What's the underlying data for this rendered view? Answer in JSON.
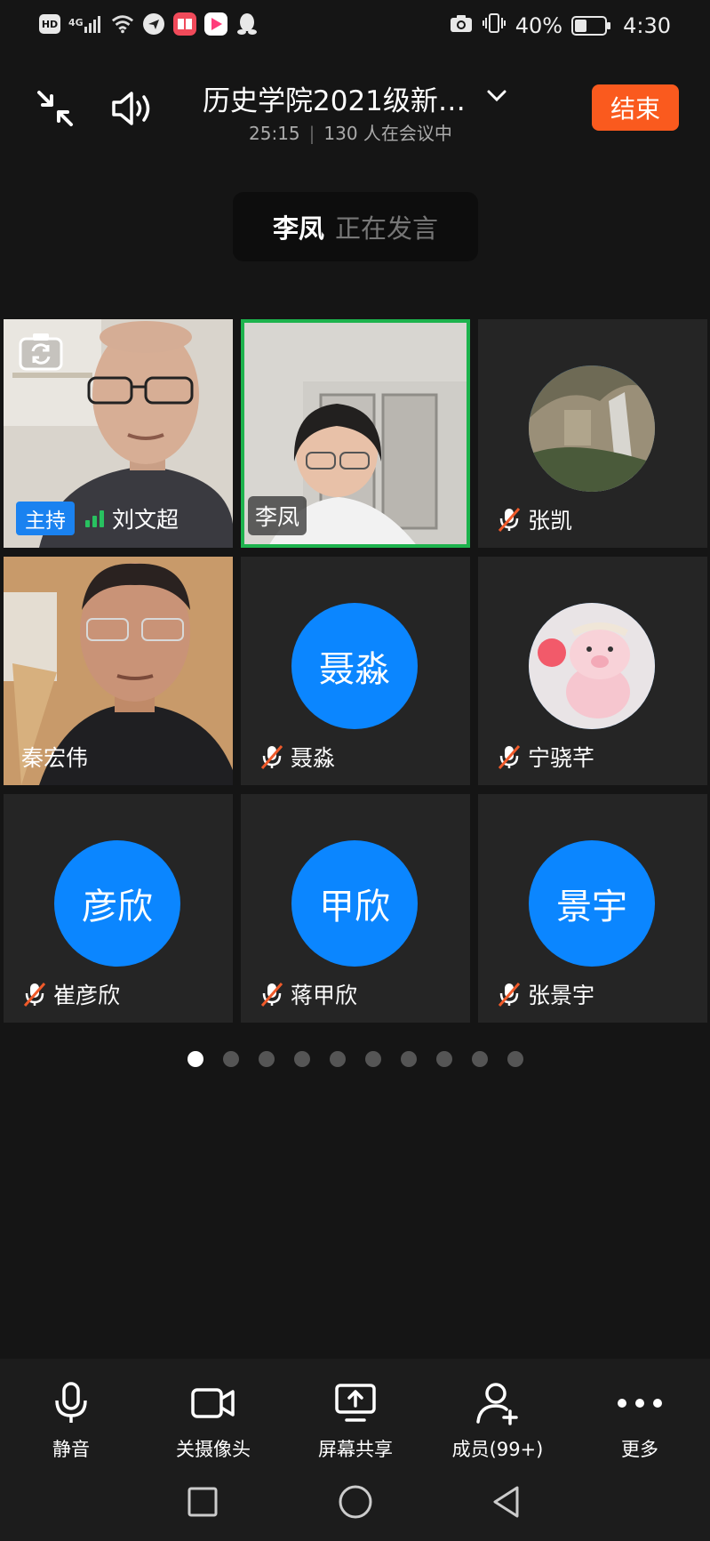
{
  "status_bar": {
    "hd_badge": "HD",
    "network": "4G",
    "battery_percent": "40%",
    "battery_level": 0.4,
    "time": "4:30"
  },
  "header": {
    "title": "历史学院2021级新…",
    "duration": "25:15",
    "participants": "130 人在会议中",
    "end_label": "结束",
    "end_color": "#fa5a1e"
  },
  "speaking": {
    "name": "李凤",
    "status": "正在发言"
  },
  "tiles": [
    {
      "name": "刘文超",
      "role": "主持",
      "kind": "video",
      "mic": "on"
    },
    {
      "name": "李凤",
      "kind": "video",
      "active": true
    },
    {
      "name": "张凯",
      "kind": "photo",
      "mic": "muted"
    },
    {
      "name": "秦宏伟",
      "kind": "video"
    },
    {
      "name": "聂淼",
      "avatar_text": "聂淼",
      "kind": "avatar",
      "mic": "muted"
    },
    {
      "name": "宁骁芊",
      "kind": "photo",
      "mic": "muted"
    },
    {
      "name": "崔彦欣",
      "avatar_text": "彦欣",
      "kind": "avatar",
      "mic": "muted"
    },
    {
      "name": "蒋甲欣",
      "avatar_text": "甲欣",
      "kind": "avatar",
      "mic": "muted"
    },
    {
      "name": "张景宇",
      "avatar_text": "景宇",
      "kind": "avatar",
      "mic": "muted"
    }
  ],
  "pagination": {
    "pages": 10,
    "current": 1
  },
  "toolbar": {
    "mute": "静音",
    "camera_off": "关摄像头",
    "screen_share": "屏幕共享",
    "members": "成员(99+)",
    "more": "更多"
  },
  "colors": {
    "accent": "#0b86ff",
    "active_speaker": "#1db34d",
    "end_button": "#fa5a1e",
    "muted_slash": "#f05a2a"
  }
}
